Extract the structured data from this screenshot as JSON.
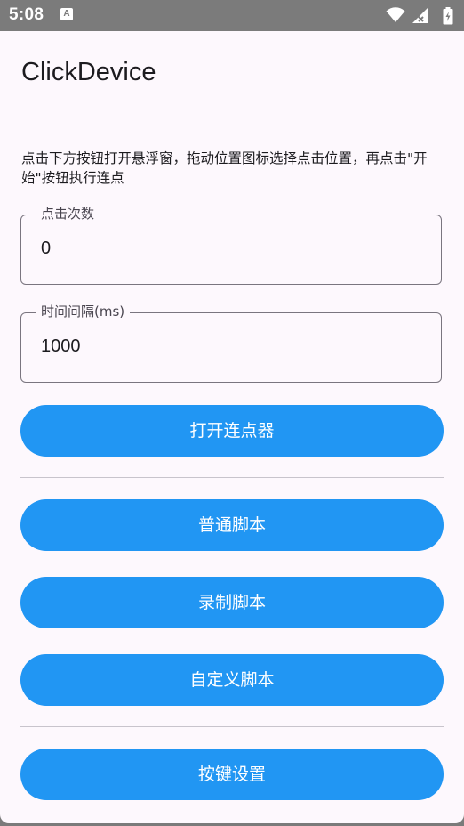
{
  "status_bar": {
    "time": "5:08",
    "notification_icon_letter": "A",
    "icons": [
      "wifi-icon",
      "signal-icon",
      "battery-charging-icon"
    ]
  },
  "app": {
    "title": "ClickDevice",
    "description": "点击下方按钮打开悬浮窗，拖动位置图标选择点击位置，再点击\"开始\"按钮执行连点"
  },
  "fields": {
    "click_count": {
      "label": "点击次数",
      "value": "0"
    },
    "interval": {
      "label": "时间间隔(ms)",
      "value": "1000"
    }
  },
  "buttons": {
    "open_clicker": "打开连点器",
    "normal_script": "普通脚本",
    "record_script": "录制脚本",
    "custom_script": "自定义脚本",
    "key_settings": "按键设置"
  },
  "colors": {
    "accent": "#2196f3",
    "background": "#fdf8fd",
    "status_bar": "#7b7b7b"
  }
}
